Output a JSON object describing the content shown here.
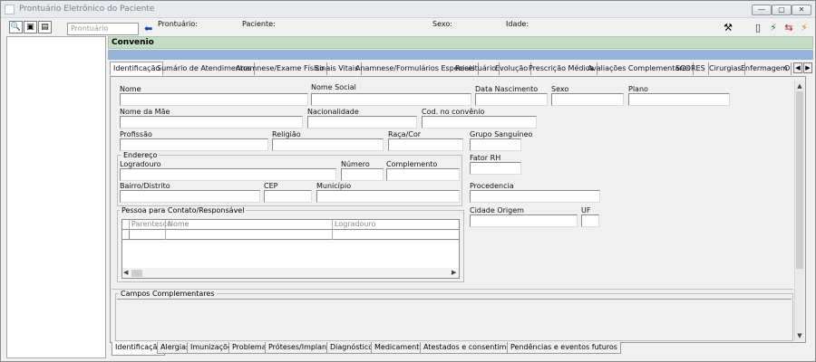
{
  "window": {
    "title": "Prontuário Eletrônico do Paciente",
    "buttons": [
      "—",
      "▢",
      "✕"
    ]
  },
  "header": {
    "prontuario_placeholder": "Prontuário",
    "prontuario_label": "Prontuário:",
    "paciente_label": "Paciente:",
    "sexo_label": "Sexo:",
    "idade_label": "Idade:"
  },
  "convenio": {
    "label": "Convenio"
  },
  "tabs_top": [
    "Identificação",
    "Sumário de Atendimentos",
    "Anamnese/Exame Físico",
    "Sinais Vitais",
    "Anamnese/Formulários Especiais",
    "Receituário",
    "Evolução",
    "Prescrição Médica",
    "Avaliações Complementares",
    "SCORES",
    "Cirurgias",
    "Enfermagem",
    "O"
  ],
  "form": {
    "nome": "Nome",
    "nome_social": "Nome Social",
    "data_nascimento": "Data Nascimento",
    "sexo": "Sexo",
    "plano": "Plano",
    "nome_mae": "Nome da Mãe",
    "nacionalidade": "Nacionalidade",
    "cod_convenio": "Cod. no convênio",
    "profissao": "Profissão",
    "religiao": "Religião",
    "raca_cor": "Raça/Cor",
    "grupo_sanguineo": "Grupo Sanguíneo",
    "fator_rh": "Fator RH",
    "endereco": "Endereço",
    "logradouro": "Logradouro",
    "numero": "Número",
    "complemento": "Complemento",
    "bairro": "Bairro/Distrito",
    "cep": "CEP",
    "municipio": "Município",
    "procedencia": "Procedencia",
    "contato_group": "Pessoa para Contato/Responsável",
    "cidade_origem": "Cidade Origem",
    "uf": "UF",
    "campos_complementares": "Campos Complementares"
  },
  "contact_grid": {
    "columns": [
      "Parentesco",
      "Nome",
      "Logradouro"
    ]
  },
  "tabs_bottom": [
    "Identificação",
    "Alergias",
    "Imunizações",
    "Problemas",
    "Próteses/Implantes",
    "Diagnósticos",
    "Medicamentos",
    "Atestados e consentimentos",
    "Pendências e eventos futuros"
  ]
}
